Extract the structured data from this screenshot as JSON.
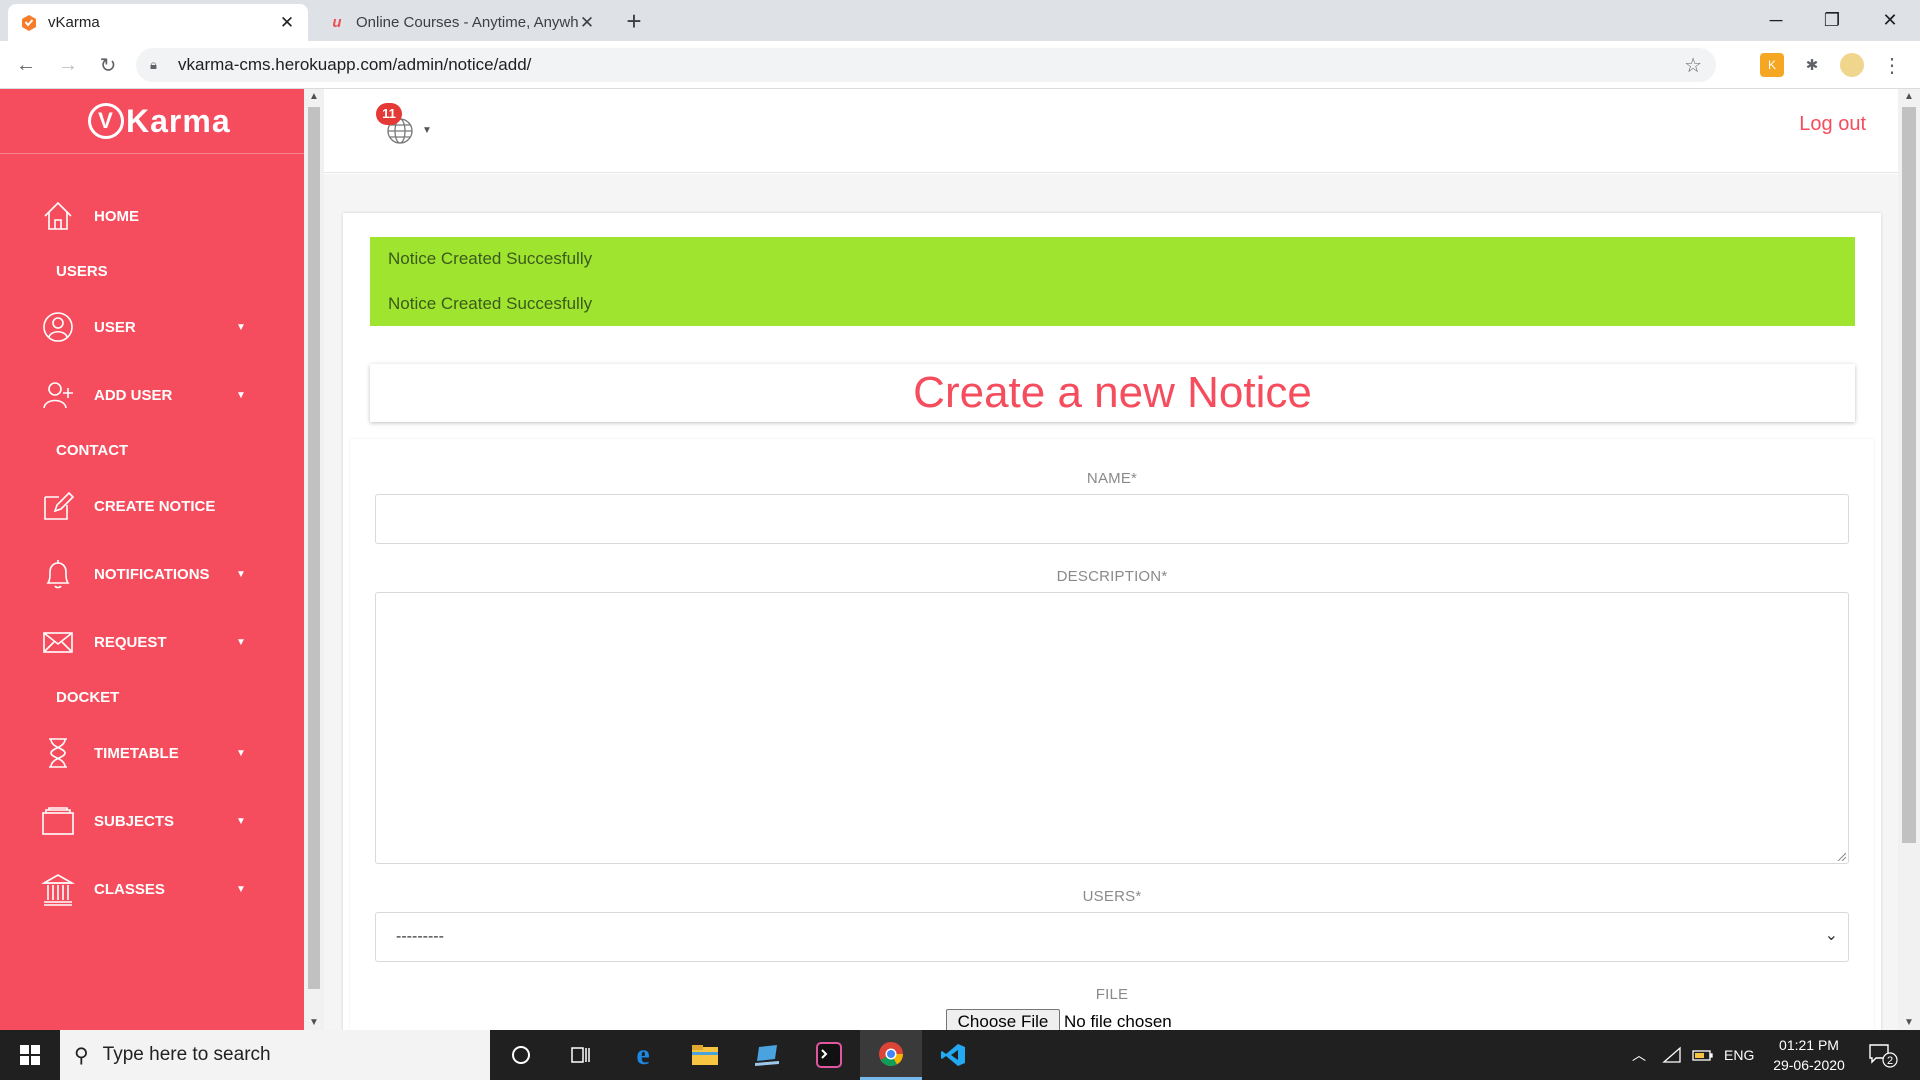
{
  "browser": {
    "tabs": [
      {
        "title": "vKarma",
        "active": true
      },
      {
        "title": "Online Courses - Anytime, Anywh",
        "active": false
      }
    ],
    "url": "vkarma-cms.herokuapp.com/admin/notice/add/"
  },
  "sidebar": {
    "logo_text": "Karma",
    "logo_mark": "V",
    "items": [
      {
        "type": "link",
        "label": "HOME",
        "icon": "home-icon"
      },
      {
        "type": "section",
        "label": "USERS"
      },
      {
        "type": "link",
        "label": "USER",
        "icon": "user-icon",
        "caret": true
      },
      {
        "type": "link",
        "label": "ADD USER",
        "icon": "add-user-icon",
        "caret": true
      },
      {
        "type": "section",
        "label": "CONTACT"
      },
      {
        "type": "link",
        "label": "CREATE NOTICE",
        "icon": "edit-icon"
      },
      {
        "type": "link",
        "label": "NOTIFICATIONS",
        "icon": "bell-icon",
        "caret": true
      },
      {
        "type": "link",
        "label": "REQUEST",
        "icon": "envelope-icon",
        "caret": true
      },
      {
        "type": "section",
        "label": "DOCKET"
      },
      {
        "type": "link",
        "label": "TIMETABLE",
        "icon": "hourglass-icon",
        "caret": true
      },
      {
        "type": "link",
        "label": "SUBJECTS",
        "icon": "folder-icon",
        "caret": true
      },
      {
        "type": "link",
        "label": "CLASSES",
        "icon": "bank-icon",
        "caret": true
      }
    ]
  },
  "topbar": {
    "notification_count": "11",
    "logout_label": "Log out"
  },
  "alerts": [
    "Notice Created Succesfully",
    "Notice Created Succesfully"
  ],
  "page_title": "Create a new Notice",
  "form": {
    "name_label": "NAME*",
    "name_value": "",
    "description_label": "DESCRIPTION*",
    "description_value": "",
    "users_label": "USERS*",
    "users_selected": "---------",
    "file_label": "FILE",
    "file_button": "Choose File",
    "file_status": "No file chosen"
  },
  "taskbar": {
    "search_placeholder": "Type here to search",
    "language": "ENG",
    "time": "01:21 PM",
    "date": "29-06-2020",
    "notification_count": "2"
  },
  "colors": {
    "brand": "#f54d5d",
    "alert_bg": "#9fe52f"
  }
}
